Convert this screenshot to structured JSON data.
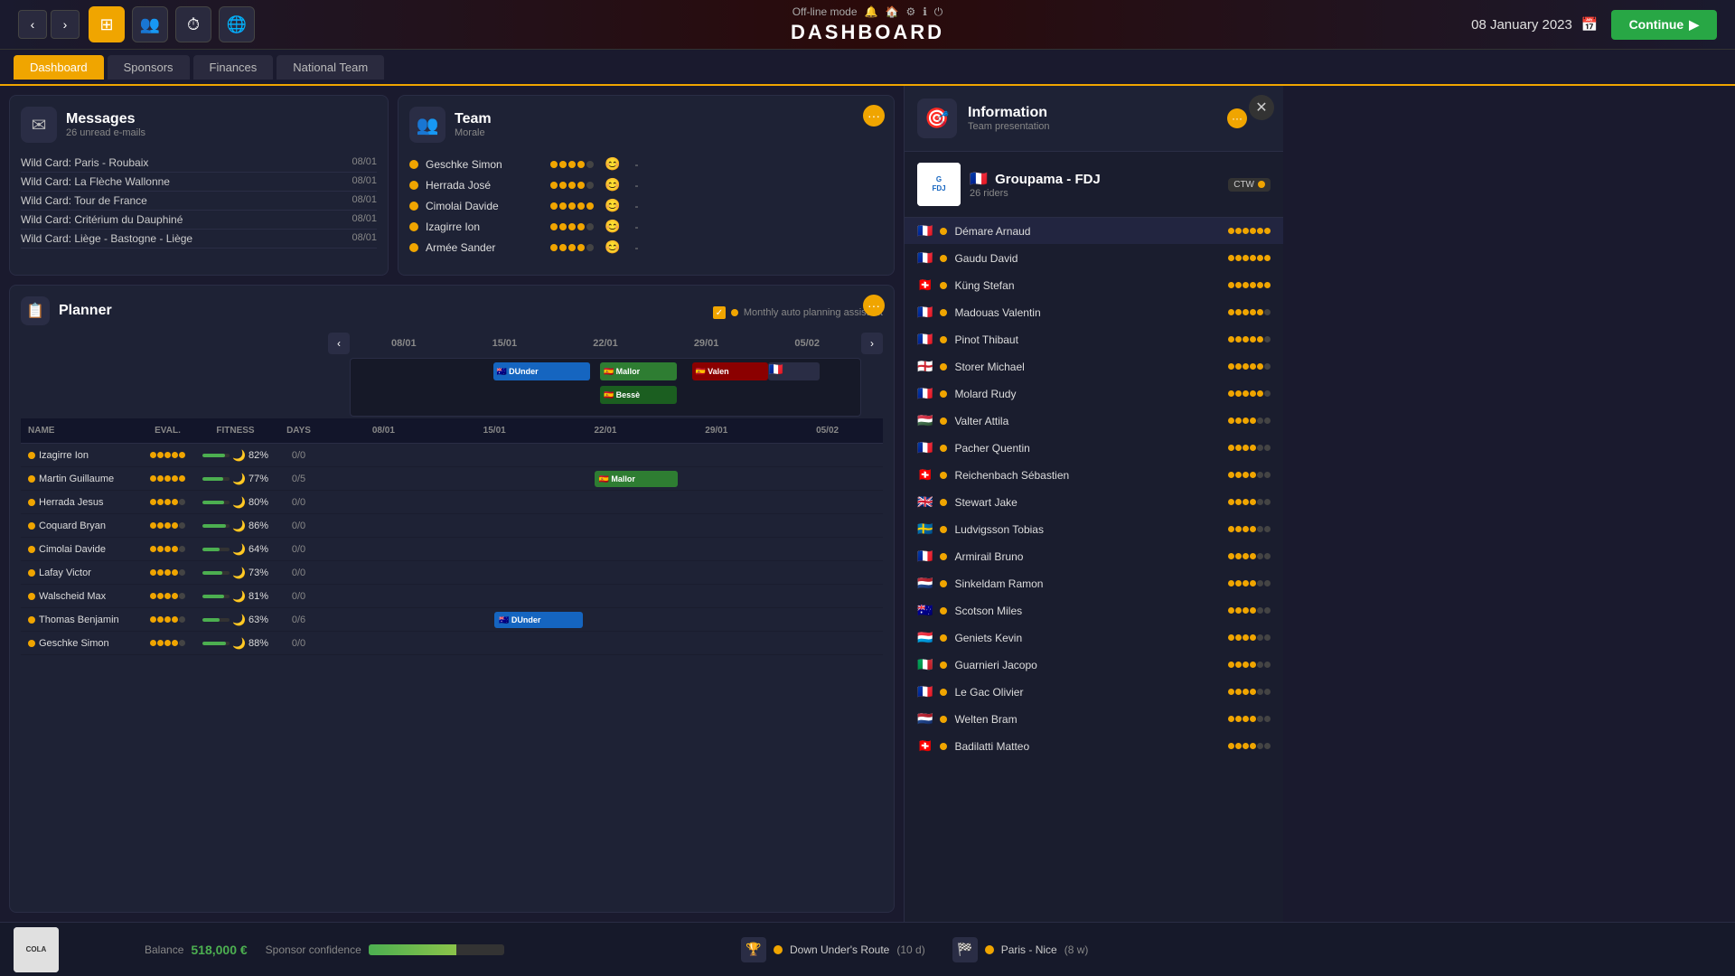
{
  "app": {
    "mode": "Off-line mode",
    "title": "DASHBOARD",
    "date": "08 January 2023",
    "continue_label": "Continue"
  },
  "tabs": {
    "active": "Dashboard",
    "items": [
      "Dashboard",
      "Sponsors",
      "Finances",
      "National Team"
    ]
  },
  "messages": {
    "title": "Messages",
    "subtitle": "26 unread e-mails",
    "items": [
      {
        "text": "Wild Card: Paris - Roubaix",
        "date": "08/01"
      },
      {
        "text": "Wild Card: La Flèche Wallonne",
        "date": "08/01"
      },
      {
        "text": "Wild Card: Tour de France",
        "date": "08/01"
      },
      {
        "text": "Wild Card: Critérium du Dauphiné",
        "date": "08/01"
      },
      {
        "text": "Wild Card: Liège - Bastogne - Liège",
        "date": "08/01"
      }
    ]
  },
  "team": {
    "title": "Team",
    "subtitle": "Morale",
    "riders": [
      {
        "name": "Geschke Simon",
        "morale": 4,
        "smile": true,
        "value": "-"
      },
      {
        "name": "Herrada José",
        "morale": 4,
        "smile": true,
        "value": "-"
      },
      {
        "name": "Cimolai Davide",
        "morale": 5,
        "smile": true,
        "value": "-"
      },
      {
        "name": "Izagirre Ion",
        "morale": 4,
        "smile": true,
        "value": "-"
      },
      {
        "name": "Armée Sander",
        "morale": 4,
        "smile": true,
        "value": "-"
      }
    ]
  },
  "planner": {
    "title": "Planner",
    "auto_planning": "Monthly auto planning assistant",
    "columns": [
      "NAME",
      "EVAL.",
      "FITNESS",
      "DAYS"
    ],
    "dates": [
      "08/01",
      "15/01",
      "22/01",
      "29/01",
      "05/02"
    ],
    "riders": [
      {
        "name": "Izagirre Ion",
        "eval": 5,
        "fitness": 82,
        "moon": true,
        "days": "0/0"
      },
      {
        "name": "Martin Guillaume",
        "eval": 5,
        "fitness": 77,
        "moon": true,
        "days": "0/5"
      },
      {
        "name": "Herrada Jesus",
        "eval": 4,
        "fitness": 80,
        "moon": true,
        "days": "0/0"
      },
      {
        "name": "Coquard Bryan",
        "eval": 4,
        "fitness": 86,
        "moon": true,
        "days": "0/0"
      },
      {
        "name": "Cimolai Davide",
        "eval": 4,
        "fitness": 64,
        "moon": true,
        "days": "0/0"
      },
      {
        "name": "Lafay Victor",
        "eval": 4,
        "fitness": 73,
        "moon": true,
        "days": "0/0"
      },
      {
        "name": "Walscheid Max",
        "eval": 4,
        "fitness": 81,
        "moon": true,
        "days": "0/0"
      },
      {
        "name": "Thomas Benjamin",
        "eval": 4,
        "fitness": 63,
        "moon": true,
        "days": "0/6"
      },
      {
        "name": "Geschke Simon",
        "eval": 4,
        "fitness": 88,
        "moon": true,
        "days": "0/0"
      }
    ],
    "races": {
      "dunder_col1": {
        "left": "30%",
        "width": "16%",
        "color": "#1565C0",
        "label": "DUnder",
        "row": "cal-strip"
      },
      "mallor_col1": {
        "left": "46%",
        "width": "14%",
        "color": "#2E7D32",
        "label": "Mallor",
        "row": "cal-strip"
      },
      "valen": {
        "left": "62%",
        "width": "12%",
        "color": "#C62828",
        "label": "Valen",
        "row": "cal-strip"
      },
      "besse": {
        "left": "62%",
        "width": "14%",
        "color": "#1B5E20",
        "label": "Bessè",
        "row": "cal-strip"
      }
    }
  },
  "information": {
    "title": "Information",
    "subtitle": "Team presentation",
    "team_name": "Groupama - FDJ",
    "team_riders_count": "26 riders",
    "ctw_label": "CTW",
    "riders": [
      {
        "name": "Démare Arnaud",
        "nat": "🇫🇷",
        "rating": 6,
        "max": 6
      },
      {
        "name": "Gaudu David",
        "nat": "🇫🇷",
        "rating": 6,
        "max": 6
      },
      {
        "name": "Küng Stefan",
        "nat": "🇨🇭",
        "rating": 6,
        "max": 6
      },
      {
        "name": "Madouas Valentin",
        "nat": "🇫🇷",
        "rating": 5,
        "max": 6
      },
      {
        "name": "Pinot Thibaut",
        "nat": "🇫🇷",
        "rating": 5,
        "max": 6
      },
      {
        "name": "Storer Michael",
        "nat": "🏴󠁧󠁢󠁥󠁮󠁧󠁿",
        "rating": 5,
        "max": 6
      },
      {
        "name": "Molard Rudy",
        "nat": "🇫🇷",
        "rating": 5,
        "max": 6
      },
      {
        "name": "Valter Attila",
        "nat": "🇭🇺",
        "rating": 4,
        "max": 6
      },
      {
        "name": "Pacher Quentin",
        "nat": "🇫🇷",
        "rating": 4,
        "max": 6
      },
      {
        "name": "Reichenbach Sébastien",
        "nat": "🇨🇭",
        "rating": 4,
        "max": 6
      },
      {
        "name": "Stewart Jake",
        "nat": "🇬🇧",
        "rating": 4,
        "max": 6
      },
      {
        "name": "Ludvigsson Tobias",
        "nat": "🇸🇪",
        "rating": 4,
        "max": 6
      },
      {
        "name": "Armirail Bruno",
        "nat": "🇫🇷",
        "rating": 4,
        "max": 6
      },
      {
        "name": "Sinkeldam Ramon",
        "nat": "🇳🇱",
        "rating": 4,
        "max": 6
      },
      {
        "name": "Scotson Miles",
        "nat": "🇦🇺",
        "rating": 4,
        "max": 6
      },
      {
        "name": "Geniets Kevin",
        "nat": "🇱🇺",
        "rating": 4,
        "max": 6
      },
      {
        "name": "Guarnieri Jacopo",
        "nat": "🇮🇹",
        "rating": 4,
        "max": 6
      },
      {
        "name": "Le Gac Olivier",
        "nat": "🇫🇷",
        "rating": 4,
        "max": 6
      },
      {
        "name": "Welten Bram",
        "nat": "🇳🇱",
        "rating": 4,
        "max": 6
      },
      {
        "name": "Badilatti Matteo",
        "nat": "🇨🇭",
        "rating": 4,
        "max": 6
      }
    ]
  },
  "bottom": {
    "balance_label": "Balance",
    "balance_value": "518,000 €",
    "sponsor_label": "Sponsor confidence",
    "events": [
      {
        "icon": "🏆",
        "name": "Down Under's Route",
        "detail": "(10 d)"
      },
      {
        "icon": "🏁",
        "name": "Paris - Nice",
        "detail": "(8 w)"
      }
    ]
  }
}
